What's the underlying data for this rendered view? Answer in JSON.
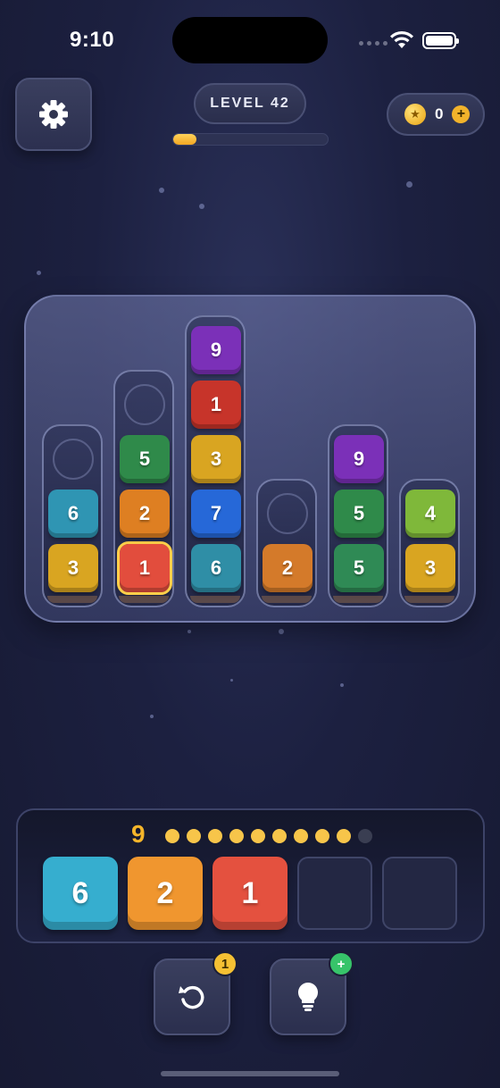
{
  "status_bar": {
    "time": "9:10"
  },
  "header": {
    "level_label": "LEVEL 42",
    "level_progress_fraction": 0.15,
    "coins": "0",
    "coin_plus": "+"
  },
  "board": {
    "tubes": [
      {
        "capacity": 3,
        "blocks": [
          {
            "value": "3",
            "color": "#d9a521"
          },
          {
            "value": "6",
            "color": "#2f95b3"
          }
        ]
      },
      {
        "capacity": 4,
        "blocks": [
          {
            "value": "1",
            "color": "#e24d3d",
            "selected": true
          },
          {
            "value": "2",
            "color": "#de7f22"
          },
          {
            "value": "5",
            "color": "#2f8a4a"
          }
        ]
      },
      {
        "capacity": 5,
        "blocks": [
          {
            "value": "6",
            "color": "#2f8ea6"
          },
          {
            "value": "7",
            "color": "#2668d8"
          },
          {
            "value": "3",
            "color": "#d9a521"
          },
          {
            "value": "1",
            "color": "#c7342a"
          },
          {
            "value": "9",
            "color": "#7b30b8"
          }
        ]
      },
      {
        "capacity": 2,
        "blocks": [
          {
            "value": "2",
            "color": "#d47a2a"
          }
        ]
      },
      {
        "capacity": 3,
        "blocks": [
          {
            "value": "5",
            "color": "#2f8a55"
          },
          {
            "value": "5",
            "color": "#2f8a4a"
          },
          {
            "value": "9",
            "color": "#7b30b8"
          }
        ]
      },
      {
        "capacity": 2,
        "blocks": [
          {
            "value": "3",
            "color": "#d9a521"
          },
          {
            "value": "4",
            "color": "#7fb83a"
          }
        ]
      }
    ]
  },
  "tray": {
    "moves_left": "9",
    "dots_total": 10,
    "dots_filled": 9,
    "tiles": [
      {
        "value": "6",
        "color": "#36aecf"
      },
      {
        "value": "2",
        "color": "#f0962f"
      },
      {
        "value": "1",
        "color": "#e4513f"
      }
    ],
    "empty_slots": 2
  },
  "tools": {
    "undo_badge": "1",
    "hint_badge": "+"
  }
}
